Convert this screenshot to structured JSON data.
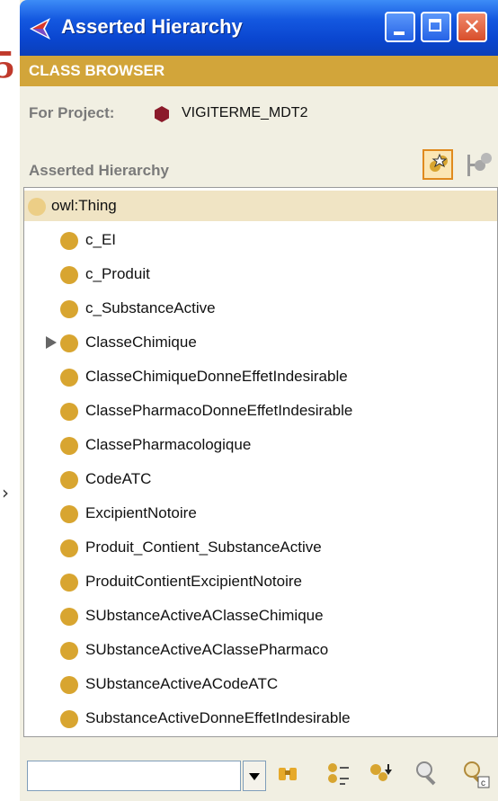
{
  "window": {
    "title": "Asserted Hierarchy",
    "panel_label": "CLASS BROWSER",
    "project_label": "For Project:",
    "project_name": "VIGITERME_MDT2",
    "hierarchy_label": "Asserted Hierarchy"
  },
  "tree": {
    "root": "owl:Thing",
    "items": [
      {
        "label": "c_EI",
        "expandable": false
      },
      {
        "label": "c_Produit",
        "expandable": false
      },
      {
        "label": "c_SubstanceActive",
        "expandable": false
      },
      {
        "label": "ClasseChimique",
        "expandable": true
      },
      {
        "label": "ClasseChimiqueDonneEffetIndesirable",
        "expandable": false
      },
      {
        "label": "ClassePharmacoDonneEffetIndesirable",
        "expandable": false
      },
      {
        "label": "ClassePharmacologique",
        "expandable": false
      },
      {
        "label": "CodeATC",
        "expandable": false
      },
      {
        "label": "ExcipientNotoire",
        "expandable": false
      },
      {
        "label": "Produit_Contient_SubstanceActive",
        "expandable": false
      },
      {
        "label": "ProduitContientExcipientNotoire",
        "expandable": false
      },
      {
        "label": "SUbstanceActiveAClasseChimique",
        "expandable": false
      },
      {
        "label": "SUbstanceActiveAClassePharmaco",
        "expandable": false
      },
      {
        "label": "SUbstanceActiveACodeATC",
        "expandable": false
      },
      {
        "label": "SubstanceActiveDonneEffetIndesirable",
        "expandable": false
      }
    ]
  },
  "search": {
    "value": ""
  },
  "colors": {
    "titlebar": "#0a46d0",
    "panel_bar": "#d2a53a",
    "class_dot": "#d8a530",
    "root_dot": "#ecce86",
    "project_icon": "#8b1a2a"
  },
  "icons": {
    "window": "protege-app-icon",
    "project": "project-hexagon-icon",
    "toolbar": [
      "create-class-icon",
      "create-subclass-icon"
    ],
    "bottom": [
      "binoculars-icon",
      "class-list-icon",
      "class-down-icon",
      "search-icon",
      "class-search-icon"
    ]
  }
}
